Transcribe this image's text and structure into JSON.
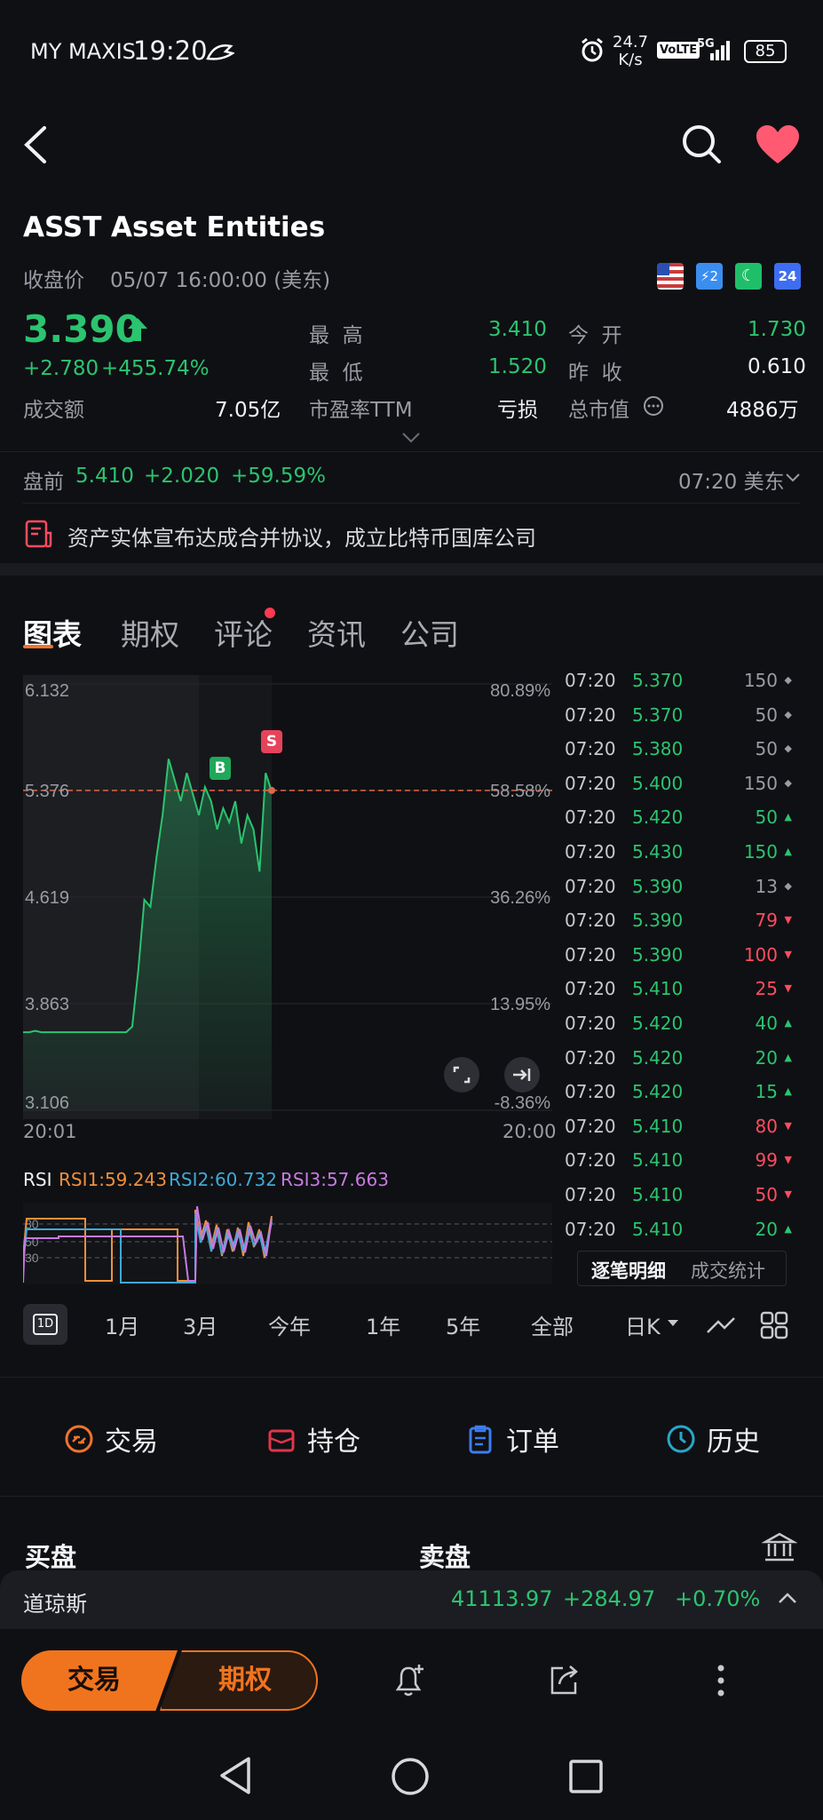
{
  "status_bar": {
    "carrier": "MY MAXIS",
    "time": "19:20",
    "speed_value": "24.7",
    "speed_unit": "K/s",
    "volte": "VoLTE",
    "net": "5G",
    "battery": "85"
  },
  "header": {
    "ticker": "ASST",
    "name": "Asset Entities",
    "close_label": "收盘价",
    "close_time": "05/07 16:00:00 (美东)",
    "badges": [
      "US",
      "⚡2",
      "☾",
      "24"
    ]
  },
  "quote": {
    "price": "3.390",
    "change": "+2.780",
    "change_pct": "+455.74%",
    "turnover_label": "成交额",
    "turnover": "7.05亿",
    "high_label": "最  高",
    "high": "3.410",
    "low_label": "最  低",
    "low": "1.520",
    "pe_label": "市盈率TTM",
    "pe": "亏损",
    "open_label": "今  开",
    "open": "1.730",
    "prev_close_label": "昨  收",
    "prev_close": "0.610",
    "mktcap_label": "总市值",
    "mktcap": "4886万"
  },
  "premarket": {
    "label": "盘前",
    "price": "5.410",
    "change": "+2.020",
    "change_pct": "+59.59%",
    "time": "07:20 美东"
  },
  "news": {
    "text": "资产实体宣布达成合并协议，成立比特币国库公司"
  },
  "tabs": [
    "图表",
    "期权",
    "评论",
    "资讯",
    "公司"
  ],
  "chart_data": {
    "type": "line",
    "y_left_labels": [
      "6.132",
      "5.376",
      "4.619",
      "3.863",
      "3.106"
    ],
    "y_right_labels": [
      "80.89%",
      "58.58%",
      "36.26%",
      "13.95%",
      "-8.36%"
    ],
    "x_labels": [
      "20:01",
      "20:00"
    ],
    "ylim": [
      3.106,
      6.132
    ],
    "ref_line": 5.376,
    "markers": [
      "B",
      "S"
    ],
    "series": [
      {
        "values": [
          3.66,
          3.66,
          3.67,
          3.66,
          3.66,
          3.66,
          3.66,
          3.66,
          3.66,
          3.66,
          3.66,
          3.66,
          3.66,
          3.66,
          3.66,
          3.66,
          3.66,
          3.66,
          3.7,
          4.1,
          4.6,
          4.55,
          4.9,
          5.2,
          5.6,
          5.45,
          5.3,
          5.5,
          5.35,
          5.2,
          5.4,
          5.3,
          5.1,
          5.25,
          5.15,
          5.3,
          5.0,
          5.2,
          5.1,
          4.8,
          5.5,
          5.37
        ]
      }
    ]
  },
  "ticks": [
    {
      "time": "07:20",
      "price": "5.370",
      "vol": "150",
      "dir": "flat"
    },
    {
      "time": "07:20",
      "price": "5.370",
      "vol": "50",
      "dir": "flat"
    },
    {
      "time": "07:20",
      "price": "5.380",
      "vol": "50",
      "dir": "flat"
    },
    {
      "time": "07:20",
      "price": "5.400",
      "vol": "150",
      "dir": "flat"
    },
    {
      "time": "07:20",
      "price": "5.420",
      "vol": "50",
      "dir": "up"
    },
    {
      "time": "07:20",
      "price": "5.430",
      "vol": "150",
      "dir": "up"
    },
    {
      "time": "07:20",
      "price": "5.390",
      "vol": "13",
      "dir": "flat"
    },
    {
      "time": "07:20",
      "price": "5.390",
      "vol": "79",
      "dir": "down"
    },
    {
      "time": "07:20",
      "price": "5.390",
      "vol": "100",
      "dir": "down"
    },
    {
      "time": "07:20",
      "price": "5.410",
      "vol": "25",
      "dir": "down"
    },
    {
      "time": "07:20",
      "price": "5.420",
      "vol": "40",
      "dir": "up"
    },
    {
      "time": "07:20",
      "price": "5.420",
      "vol": "20",
      "dir": "up"
    },
    {
      "time": "07:20",
      "price": "5.420",
      "vol": "15",
      "dir": "up"
    },
    {
      "time": "07:20",
      "price": "5.410",
      "vol": "80",
      "dir": "down"
    },
    {
      "time": "07:20",
      "price": "5.410",
      "vol": "99",
      "dir": "down"
    },
    {
      "time": "07:20",
      "price": "5.410",
      "vol": "50",
      "dir": "down"
    },
    {
      "time": "07:20",
      "price": "5.410",
      "vol": "20",
      "dir": "up"
    }
  ],
  "tick_tabs": [
    "逐笔明细",
    "成交统计"
  ],
  "rsi": {
    "label": "RSI",
    "rsi1": "RSI1:59.243",
    "rsi2": "RSI2:60.732",
    "rsi3": "RSI3:57.663",
    "levels": [
      "80",
      "50",
      "30"
    ]
  },
  "ranges": [
    "1D",
    "1月",
    "3月",
    "今年",
    "1年",
    "5年",
    "全部",
    "日K"
  ],
  "actions": [
    {
      "label": "交易",
      "color": "#f0742a"
    },
    {
      "label": "持仓",
      "color": "#e0364a"
    },
    {
      "label": "订单",
      "color": "#3d7df0"
    },
    {
      "label": "历史",
      "color": "#2aa6c9"
    }
  ],
  "orderbook": {
    "buy": "买盘",
    "sell": "卖盘"
  },
  "index_bar": {
    "name": "道琼斯",
    "value": "41113.97",
    "change": "+284.97",
    "change_pct": "+0.70%"
  },
  "bottom": {
    "trade": "交易",
    "options": "期权"
  }
}
